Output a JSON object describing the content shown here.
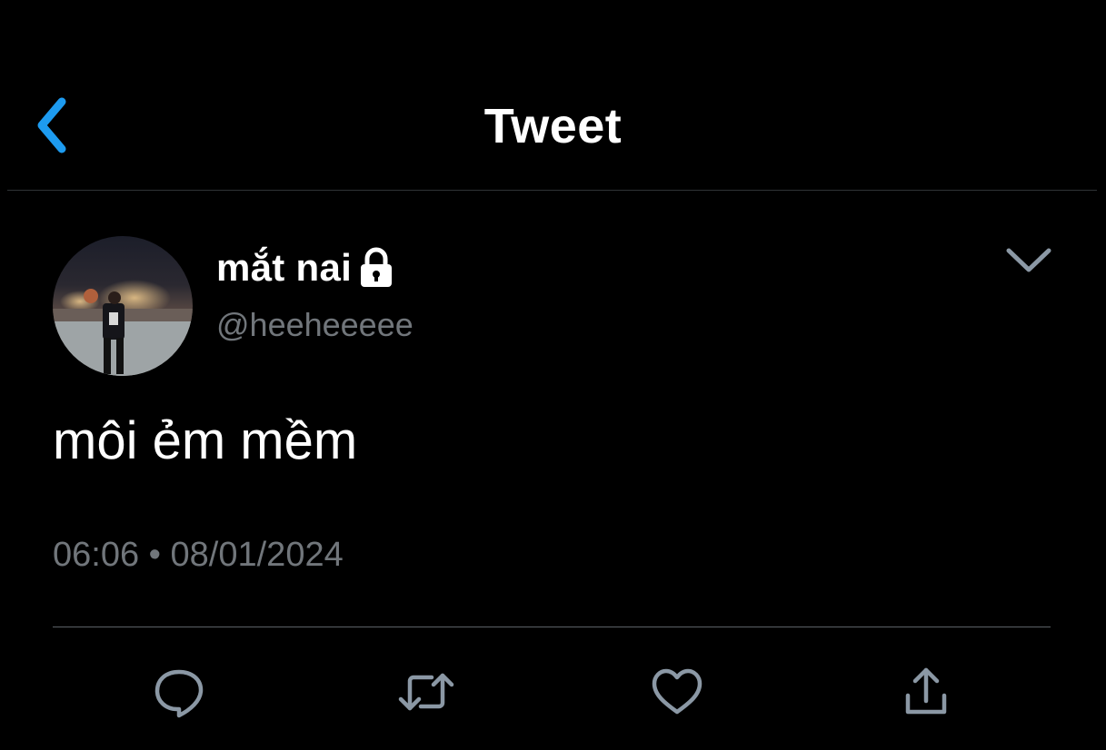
{
  "header": {
    "title": "Tweet",
    "back_icon": "chevron-left-icon"
  },
  "tweet": {
    "author": {
      "display_name": "mắt nai",
      "handle": "@heeheeeee",
      "protected_icon": "lock-icon"
    },
    "text": "môi ẻm mềm",
    "time": "06:06",
    "separator": "•",
    "date": "08/01/2024"
  },
  "actions": [
    {
      "name": "reply",
      "icon": "reply-icon"
    },
    {
      "name": "retweet",
      "icon": "retweet-icon"
    },
    {
      "name": "like",
      "icon": "heart-icon"
    },
    {
      "name": "share",
      "icon": "share-icon"
    }
  ],
  "colors": {
    "background": "#000000",
    "accent": "#1d9bf0",
    "text_primary": "#ffffff",
    "text_secondary": "#71767b",
    "icon_gray": "#8b98a5"
  }
}
